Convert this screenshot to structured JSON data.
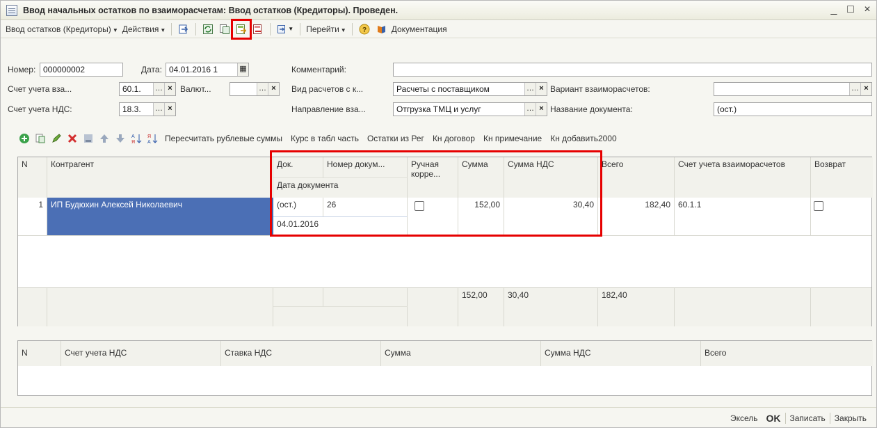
{
  "window": {
    "title": "Ввод начальных остатков по взаиморасчетам: Ввод остатков (Кредиторы). Проведен.",
    "min": "_",
    "max": "□",
    "close": "×"
  },
  "toolbar": {
    "menu1": "Ввод остатков (Кредиторы)",
    "menu2": "Действия",
    "menu3": "Перейти",
    "doc_link": "Документация"
  },
  "header": {
    "number_label": "Номер:",
    "number_value": "000000002",
    "date_label": "Дата:",
    "date_value": "04.01.2016 1",
    "comment_label": "Комментарий:",
    "comment_value": "",
    "account_label": "Счет учета вза...",
    "account_value": "60.1.",
    "currency_label": "Валют...",
    "currency_value": "",
    "calc_type_label": "Вид расчетов с к...",
    "calc_type_value": "Расчеты с поставщиком",
    "variant_label": "Вариант взаиморасчетов:",
    "variant_value": "",
    "vat_account_label": "Счет учета НДС:",
    "vat_account_value": "18.3.",
    "direction_label": "Направление вза...",
    "direction_value": "Отгрузка ТМЦ и услуг",
    "docname_label": "Название документа:",
    "docname_value": "(ост.)"
  },
  "table_toolbar": {
    "links": [
      "Пересчитать рублевые суммы",
      "Курс в табл часть",
      "Остатки из Рег",
      "Кн договор",
      "Кн примечание",
      "Кн добавить2000"
    ]
  },
  "grid": {
    "headers": {
      "n": "N",
      "contractor": "Контрагент",
      "doc": "Док.",
      "docnum": "Номер докум...",
      "docdate": "Дата документа",
      "manual": "Ручная корре...",
      "sum": "Сумма",
      "vat": "Сумма НДС",
      "total": "Всего",
      "account": "Счет учета взаиморасчетов",
      "return": "Возврат"
    },
    "rows": [
      {
        "n": "1",
        "contractor": "ИП Будюхин Алексей Николаевич",
        "doc": "(ост.)",
        "docnum": "26",
        "docdate": "04.01.2016",
        "sum": "152,00",
        "vat": "30,40",
        "total": "182,40",
        "account": "60.1.1"
      }
    ],
    "totals": {
      "sum": "152,00",
      "vat": "30,40",
      "total": "182,40"
    }
  },
  "grid2": {
    "headers": {
      "n": "N",
      "vat_account": "Счет учета НДС",
      "vat_rate": "Ставка НДС",
      "sum": "Сумма",
      "vat": "Сумма НДС",
      "total": "Всего"
    }
  },
  "bottom": {
    "excel": "Эксель",
    "ok": "OK",
    "save": "Записать",
    "close": "Закрыть"
  },
  "colors": {
    "highlight": "#e60000",
    "selection": "#4b6fb5"
  }
}
